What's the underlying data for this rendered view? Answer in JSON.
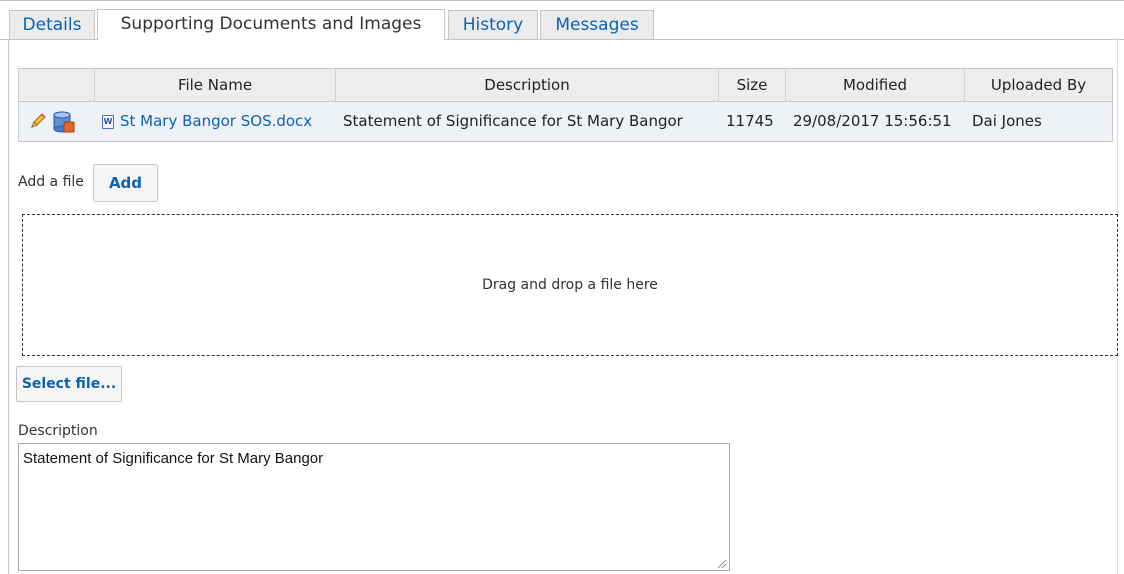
{
  "tabs": [
    {
      "label": "Details",
      "active": false
    },
    {
      "label": "Supporting Documents and Images",
      "active": true
    },
    {
      "label": "History",
      "active": false
    },
    {
      "label": "Messages",
      "active": false
    }
  ],
  "grid": {
    "headers": [
      "",
      "File Name",
      "Description",
      "Size",
      "Modified",
      "Uploaded By"
    ],
    "rows": [
      {
        "file_name": "St Mary Bangor SOS.docx",
        "file_icon": "word-document-icon",
        "description": "Statement of Significance for St Mary Bangor",
        "size": "11745",
        "modified": "29/08/2017 15:56:51",
        "uploaded_by": "Dai Jones"
      }
    ]
  },
  "upload": {
    "add_label": "Add a file",
    "add_button": "Add",
    "dropzone_text": "Drag and drop a file here",
    "select_button": "Select file...",
    "description_label": "Description",
    "description_value": "Statement of Significance for St Mary Bangor"
  },
  "colors": {
    "link": "#0b63b4",
    "header_bg": "#ededed",
    "row_bg": "#eef1f6"
  }
}
